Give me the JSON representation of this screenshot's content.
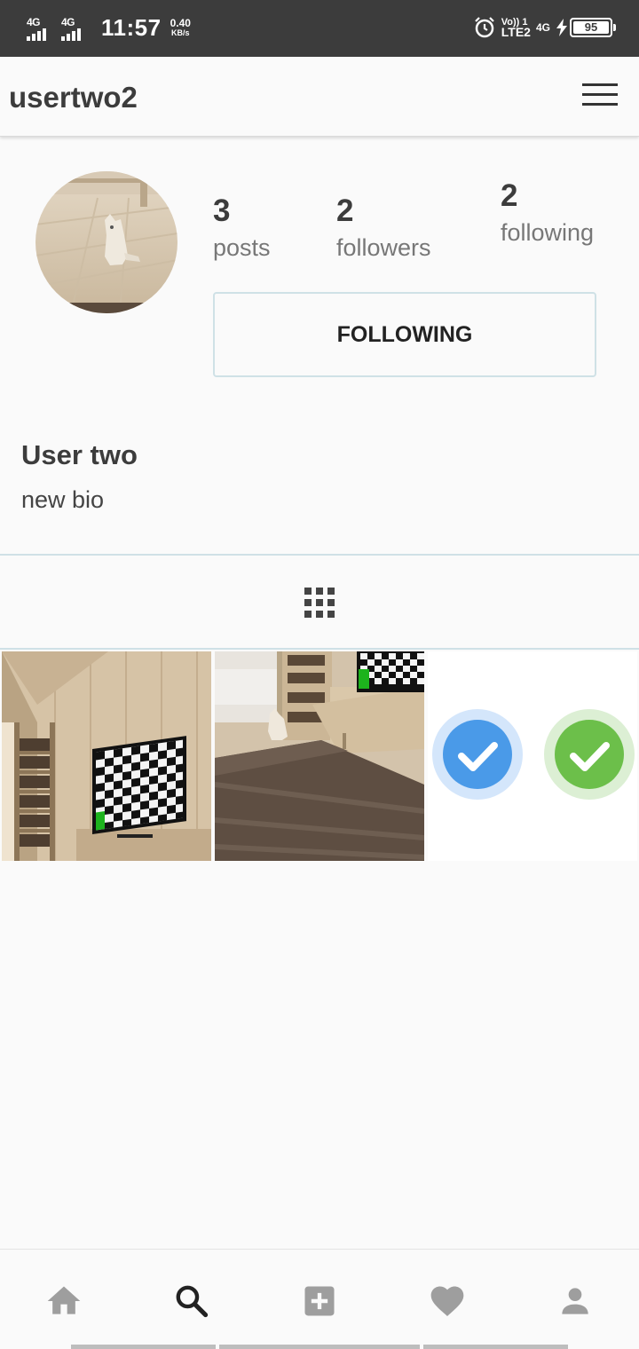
{
  "status_bar": {
    "network_left_1": "4G",
    "network_left_2": "4G",
    "time": "11:57",
    "speed_value": "0.40",
    "speed_unit": "KB/s",
    "volte_top": "Vo)) 1",
    "volte_bottom": "LTE2",
    "network_right": "4G",
    "battery": "95"
  },
  "header": {
    "username": "usertwo2"
  },
  "profile": {
    "posts_count": "3",
    "posts_label": "posts",
    "followers_count": "2",
    "followers_label": "followers",
    "following_count": "2",
    "following_label": "following",
    "follow_button_label": "FOLLOWING",
    "display_name": "User two",
    "bio": "new bio"
  },
  "posts": [
    {
      "icon": "room-tv-photo"
    },
    {
      "icon": "room-cat-photo"
    },
    {
      "icon": "checkmark-badges-photo"
    }
  ],
  "bottom_nav": {
    "items": [
      "home-icon",
      "search-icon",
      "add-icon",
      "heart-icon",
      "profile-icon"
    ]
  },
  "colors": {
    "status_bar": "#3c3c3c",
    "background": "#fafafa",
    "divider": "#cfe1e6",
    "nav_icon": "#9e9e9e",
    "check_blue": "#4a9ae8",
    "check_green": "#6cbf4a"
  }
}
